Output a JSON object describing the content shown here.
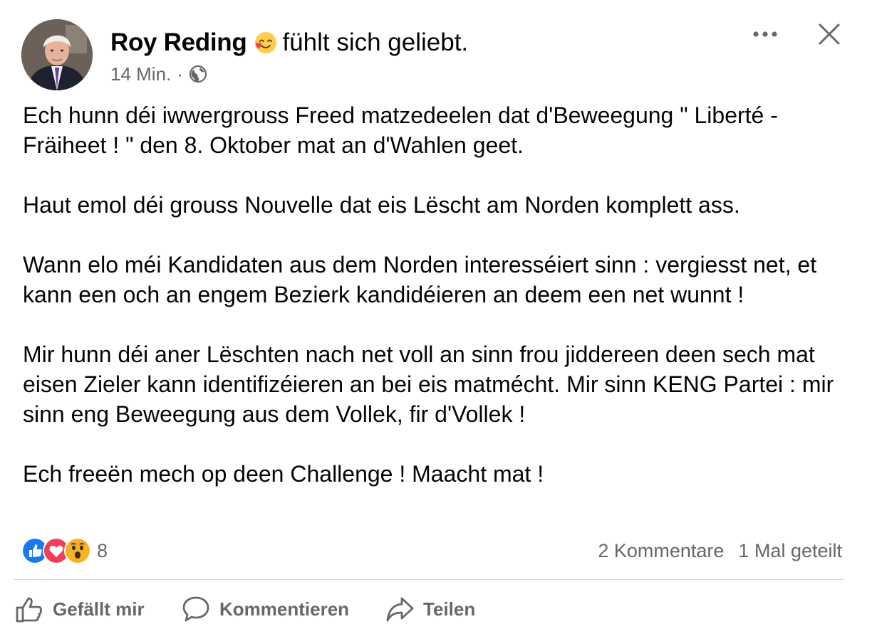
{
  "post": {
    "author": "Roy Reding",
    "feeling_icon": "smiling-face-with-hearts-emoji",
    "feeling_text": "fühlt sich geliebt.",
    "time": "14 Min.",
    "separator": "·",
    "privacy_icon": "globe-icon",
    "paragraphs": [
      "Ech hunn déi iwwergrouss Freed matzedeelen dat d'Beweegung \" Liberté - Fräiheet ! \" den 8. Oktober mat an d'Wahlen geet.",
      "Haut emol déi grouss Nouvelle dat eis Lëscht am Norden komplett ass.",
      "Wann elo méi Kandidaten aus dem Norden interesséiert sinn : vergiesst net, et kann een och an engem Bezierk kandidéieren an deem een net wunnt !",
      "Mir hunn déi aner Lëschten nach net voll an sinn frou jiddereen deen sech mat eisen Zieler kann identifizéieren an bei eis matmécht. Mir sinn KENG Partei : mir sinn eng Beweegung aus dem Vollek, fir d'Vollek !",
      "Ech freeën mech op deen Challenge ! Maacht mat !"
    ]
  },
  "reactions": {
    "icons": [
      "like-icon",
      "love-icon",
      "wow-icon"
    ],
    "count": "8"
  },
  "stats": {
    "comments": "2 Kommentare",
    "shares": "1 Mal geteilt"
  },
  "actions": {
    "like": "Gefällt mir",
    "comment": "Kommentieren",
    "share": "Teilen"
  },
  "colors": {
    "text": "#050505",
    "secondary": "#65676b",
    "like_blue": "#1877f2",
    "love_red": "#f33e58",
    "wow_yellow": "#f7b125"
  }
}
